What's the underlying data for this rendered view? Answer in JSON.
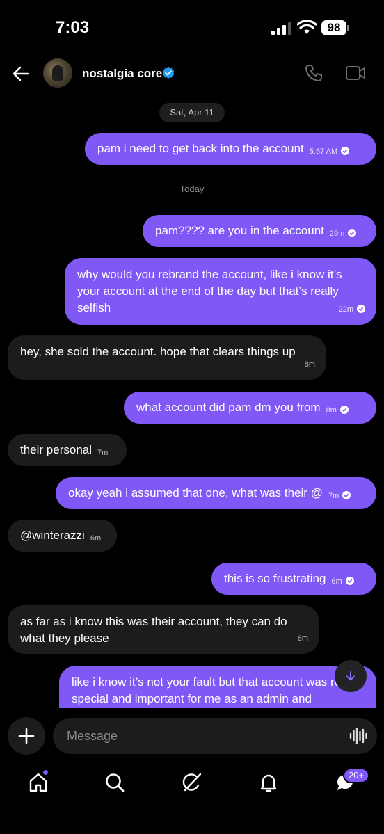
{
  "status_bar": {
    "time": "7:03",
    "battery": "98"
  },
  "header": {
    "title": "nostalgia core"
  },
  "date_separator": "Sat, Apr 11",
  "today_label": "Today",
  "messages": [
    {
      "text": "pam i need to get back into the account",
      "time": "5:57 AM"
    },
    {
      "text": "pam???? are you in the account",
      "time": "29m"
    },
    {
      "text": "why would you rebrand the account, like i know it’s your account at the end of the day but that’s really selfish",
      "time": "22m"
    },
    {
      "text": "hey, she sold the account. hope that clears things up",
      "time": "8m"
    },
    {
      "text": "what account did pam dm you from",
      "time": "8m"
    },
    {
      "text": "their personal",
      "time": "7m"
    },
    {
      "text": "okay yeah i assumed that one, what was their @",
      "time": "7m"
    },
    {
      "text": "@winterazzi",
      "time": "6m"
    },
    {
      "text": "this is so frustrating",
      "time": "6m"
    },
    {
      "text": "as far as i know this was their account, they can do what they please",
      "time": "6m"
    },
    {
      "text": "like i know it’s not your fault but that account was really special and important for me as an admin and",
      "time": ""
    }
  ],
  "composer": {
    "placeholder": "Message"
  },
  "nav": {
    "messages_badge": "20+"
  },
  "colors": {
    "accent": "#7f58f5",
    "incoming_bubble": "#1c1c1e",
    "verified": "#1d9bf0"
  },
  "icons": [
    "back-arrow-icon",
    "verified-icon",
    "phone-icon",
    "video-icon",
    "arrow-down-icon",
    "plus-icon",
    "voice-wave-icon",
    "home-icon",
    "search-icon",
    "grok-icon",
    "bell-icon",
    "messages-icon"
  ]
}
